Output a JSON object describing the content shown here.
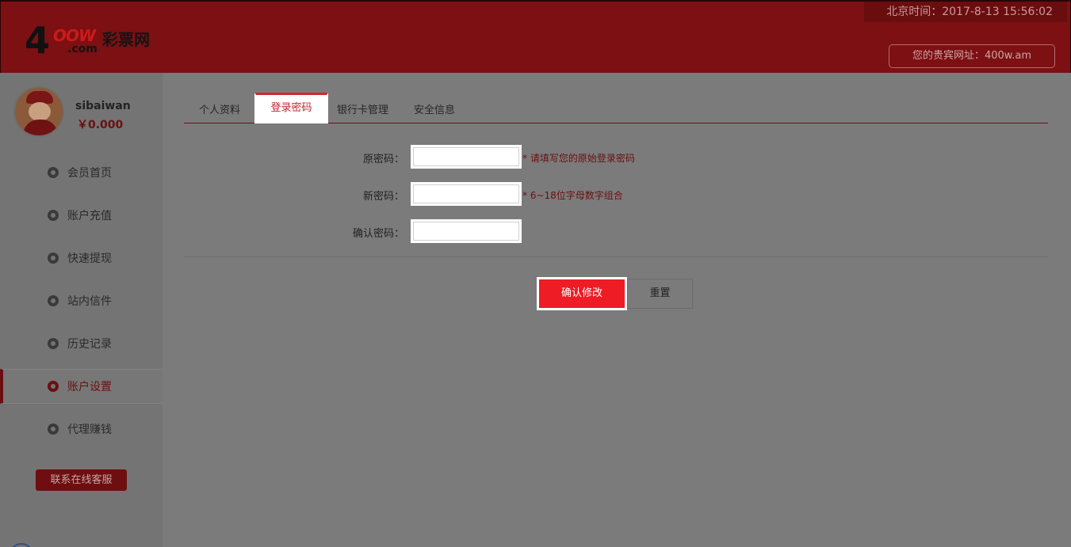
{
  "header": {
    "logo_digit": "4",
    "logo_oow": "OOW",
    "logo_cn": "彩票网",
    "logo_com": ".com",
    "clock": "北京时间：2017-8-13 15:56:02",
    "vip_site": "您的贵宾网址：400w.am"
  },
  "user": {
    "name": "sibaiwan",
    "balance": "￥0.000"
  },
  "sidebar": {
    "items": [
      {
        "label": "会员首页",
        "icon": "home-icon"
      },
      {
        "label": "账户充值",
        "icon": "deposit-icon"
      },
      {
        "label": "快速提现",
        "icon": "withdraw-icon"
      },
      {
        "label": "站内信件",
        "icon": "mail-icon"
      },
      {
        "label": "历史记录",
        "icon": "clock-icon"
      },
      {
        "label": "账户设置",
        "icon": "gear-icon",
        "active": true
      },
      {
        "label": "代理赚钱",
        "icon": "money-icon"
      }
    ],
    "service_button": "联系在线客服"
  },
  "tabs": [
    {
      "label": "个人资料"
    },
    {
      "label": "登录密码",
      "active": true
    },
    {
      "label": "银行卡管理"
    },
    {
      "label": "安全信息"
    }
  ],
  "form": {
    "old_password": {
      "label": "原密码：",
      "value": "",
      "hint": "* 请填写您的原始登录密码"
    },
    "new_password": {
      "label": "新密码：",
      "value": "",
      "hint": "* 6~18位字母数字组合"
    },
    "confirm_password": {
      "label": "确认密码：",
      "value": ""
    },
    "confirm_button": "确认修改",
    "reset_button": "重置"
  },
  "colors": {
    "header_bg": "#7c1013",
    "accent": "#ee1c25",
    "overlay_gray": "#7b7b7b"
  }
}
